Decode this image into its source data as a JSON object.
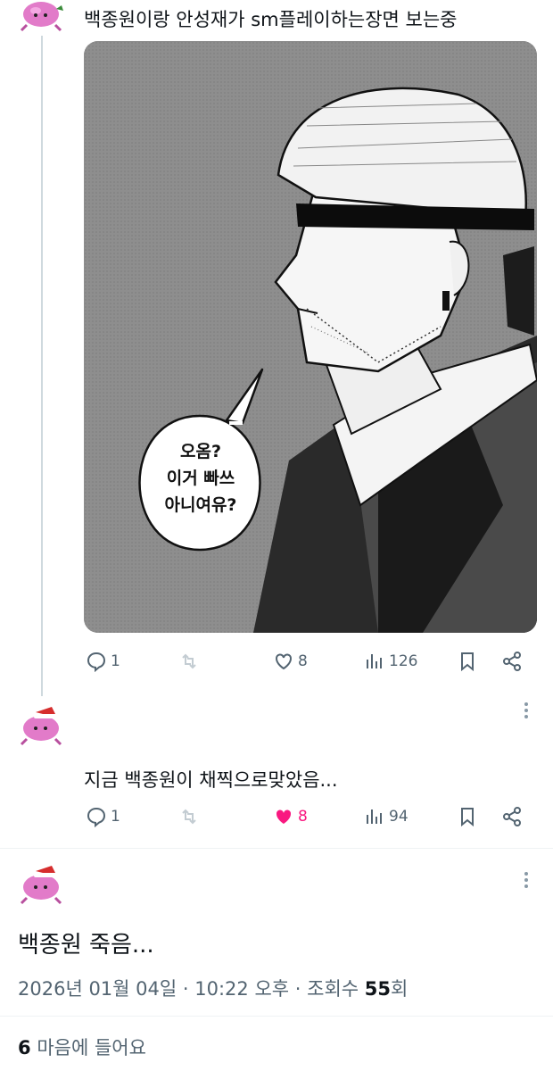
{
  "posts": [
    {
      "text": "백종원이랑 안성재가 sm플레이하는장면 보는중",
      "image": {
        "speech_lines": [
          "오옴?",
          "이거 빠쓰",
          "아니여유?"
        ]
      },
      "actions": {
        "replies": "1",
        "likes": "8",
        "views": "126"
      }
    },
    {
      "text": "지금 백종원이 채찍으로맞았음...",
      "actions": {
        "replies": "1",
        "likes": "8",
        "views": "94"
      },
      "liked": true
    }
  ],
  "focused_post": {
    "text": "백종원 죽음...",
    "date": "2026년 01월 04일",
    "time": "10:22 오후",
    "views_label": "조회수",
    "views_count": "55",
    "views_suffix": "회",
    "likes_count": "6",
    "likes_label": "마음에 들어요"
  },
  "colors": {
    "accent_like": "#f91880",
    "muted": "#536471",
    "text": "#0f1419"
  },
  "icons": [
    "reply-icon",
    "repost-icon",
    "heart-icon",
    "views-icon",
    "bookmark-icon",
    "share-icon",
    "more-icon"
  ]
}
